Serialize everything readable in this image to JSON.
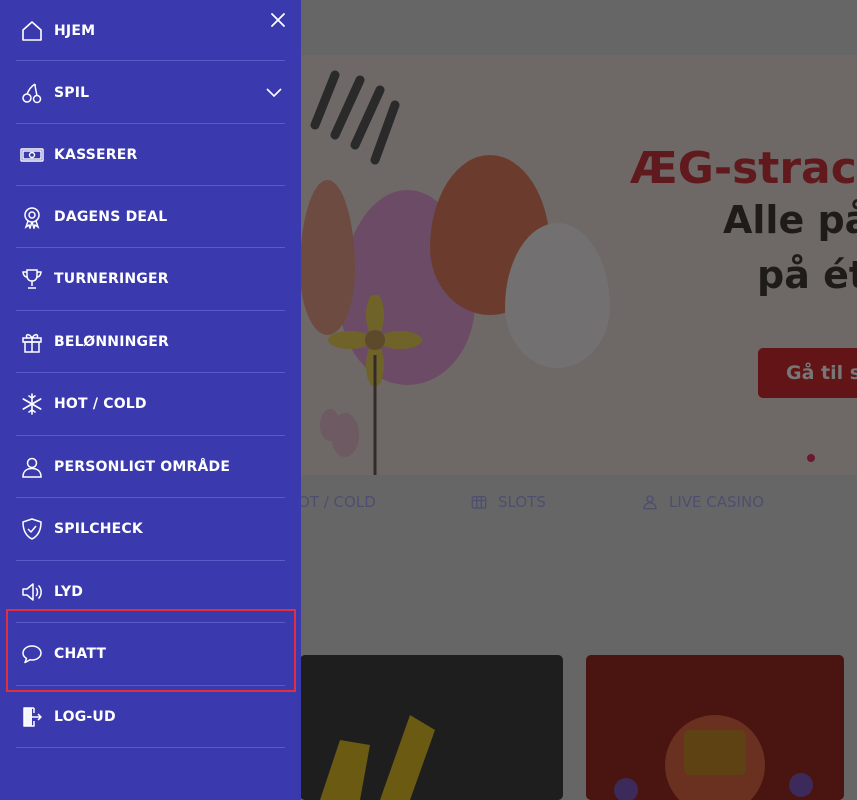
{
  "menu": {
    "close_icon": "close-icon",
    "items": [
      {
        "label": "HJEM",
        "icon": "home-icon"
      },
      {
        "label": "SPIL",
        "icon": "cherry-icon"
      },
      {
        "label": "KASSERER",
        "icon": "banknote-icon"
      },
      {
        "label": "DAGENS DEAL",
        "icon": "rosette-icon"
      },
      {
        "label": "TURNERINGER",
        "icon": "trophy-icon"
      },
      {
        "label": "BELØNNINGER",
        "icon": "gift-icon"
      },
      {
        "label": "HOT / COLD",
        "icon": "snowflake-icon"
      },
      {
        "label": "PERSONLIGT OMRÅDE",
        "icon": "user-icon"
      },
      {
        "label": "SPILCHECK",
        "icon": "shield-check-icon"
      },
      {
        "label": "LYD",
        "icon": "speaker-icon"
      },
      {
        "label": "CHATT",
        "icon": "chat-bubble-icon"
      },
      {
        "label": "LOG-UD",
        "icon": "logout-icon"
      }
    ],
    "spil_expand_icon": "chevron-down-icon",
    "background_color": "#3a3aae",
    "highlight_color": "#e0303d"
  },
  "background": {
    "hero": {
      "title": "ÆG-strac",
      "line1": "Alle på",
      "line2": "på ét",
      "cta": "Gå til s"
    },
    "categories": [
      {
        "label": "OT / COLD",
        "icon": ""
      },
      {
        "label": "SLOTS",
        "icon": "slot-machine-icon"
      },
      {
        "label": "LIVE CASINO",
        "icon": "dealer-icon"
      }
    ]
  }
}
